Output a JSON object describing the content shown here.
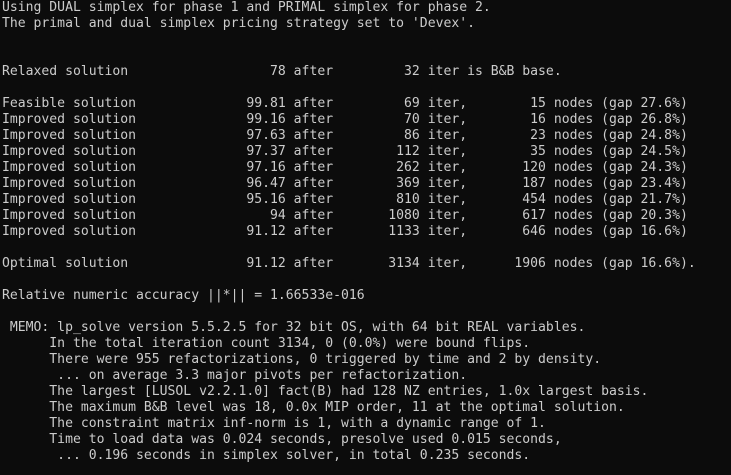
{
  "console": {
    "lines": [
      "Using DUAL simplex for phase 1 and PRIMAL simplex for phase 2.",
      "The primal and dual simplex pricing strategy set to 'Devex'.",
      "",
      "",
      "Relaxed solution                  78 after         32 iter is B&B base.",
      "",
      "Feasible solution              99.81 after         69 iter,        15 nodes (gap 27.6%)",
      "Improved solution              99.16 after         70 iter,        16 nodes (gap 26.8%)",
      "Improved solution              97.63 after         86 iter,        23 nodes (gap 24.8%)",
      "Improved solution              97.37 after        112 iter,        35 nodes (gap 24.5%)",
      "Improved solution              97.16 after        262 iter,       120 nodes (gap 24.3%)",
      "Improved solution              96.47 after        369 iter,       187 nodes (gap 23.4%)",
      "Improved solution              95.16 after        810 iter,       454 nodes (gap 21.7%)",
      "Improved solution                 94 after       1080 iter,       617 nodes (gap 20.3%)",
      "Improved solution              91.12 after       1133 iter,       646 nodes (gap 16.6%)",
      "",
      "Optimal solution               91.12 after       3134 iter,      1906 nodes (gap 16.6%).",
      "",
      "Relative numeric accuracy ||*|| = 1.66533e-016",
      "",
      " MEMO: lp_solve version 5.5.2.5 for 32 bit OS, with 64 bit REAL variables.",
      "      In the total iteration count 3134, 0 (0.0%) were bound flips.",
      "      There were 955 refactorizations, 0 triggered by time and 2 by density.",
      "       ... on average 3.3 major pivots per refactorization.",
      "      The largest [LUSOL v2.2.1.0] fact(B) had 128 NZ entries, 1.0x largest basis.",
      "      The maximum B&B level was 18, 0.0x MIP order, 11 at the optimal solution.",
      "      The constraint matrix inf-norm is 1, with a dynamic range of 1.",
      "      Time to load data was 0.024 seconds, presolve used 0.015 seconds,",
      "       ... 0.196 seconds in simplex solver, in total 0.235 seconds."
    ]
  }
}
